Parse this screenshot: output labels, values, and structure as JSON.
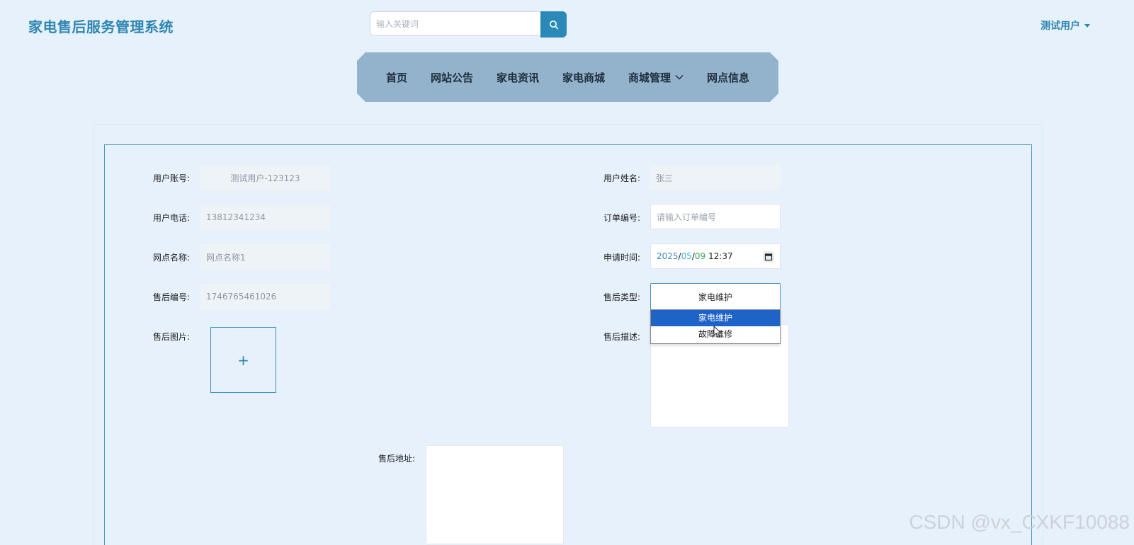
{
  "header": {
    "site_title": "家电售后服务管理系统",
    "search_placeholder": "输入关键词",
    "search_icon": "search-icon",
    "user_name": "测试用户"
  },
  "nav": {
    "items": [
      {
        "label": "首页"
      },
      {
        "label": "网站公告"
      },
      {
        "label": "家电资讯"
      },
      {
        "label": "家电商城"
      },
      {
        "label": "商城管理",
        "has_dropdown": true
      },
      {
        "label": "网点信息"
      }
    ]
  },
  "form": {
    "user_account": {
      "label": "用户账号:",
      "value": "测试用户-123123"
    },
    "user_name": {
      "label": "用户姓名:",
      "value": "张三"
    },
    "user_phone": {
      "label": "用户电话:",
      "value": "13812341234"
    },
    "order_no": {
      "label": "订单编号:",
      "placeholder": "请输入订单编号"
    },
    "outlet_name": {
      "label": "网点名称:",
      "value": "网点名称1"
    },
    "apply_time": {
      "label": "申请时间:",
      "year": "2025",
      "month": "05",
      "day": "09",
      "time": "12:37",
      "sep": "/"
    },
    "service_no": {
      "label": "售后编号:",
      "value": "1746765461026"
    },
    "service_type": {
      "label": "售后类型:",
      "value": "家电维护",
      "options": [
        "家电维护",
        "故障维修"
      ]
    },
    "service_image": {
      "label": "售后图片:",
      "upload_symbol": "+"
    },
    "service_desc": {
      "label": "售后描述:"
    },
    "service_address": {
      "label": "售后地址:"
    }
  },
  "watermark": "CSDN @vx_CXKF10088",
  "colors": {
    "accent": "#2f86b3",
    "nav_bg": "#93b3cd",
    "page_bg": "#e6f1fb",
    "selected_option": "#1e63c7"
  }
}
